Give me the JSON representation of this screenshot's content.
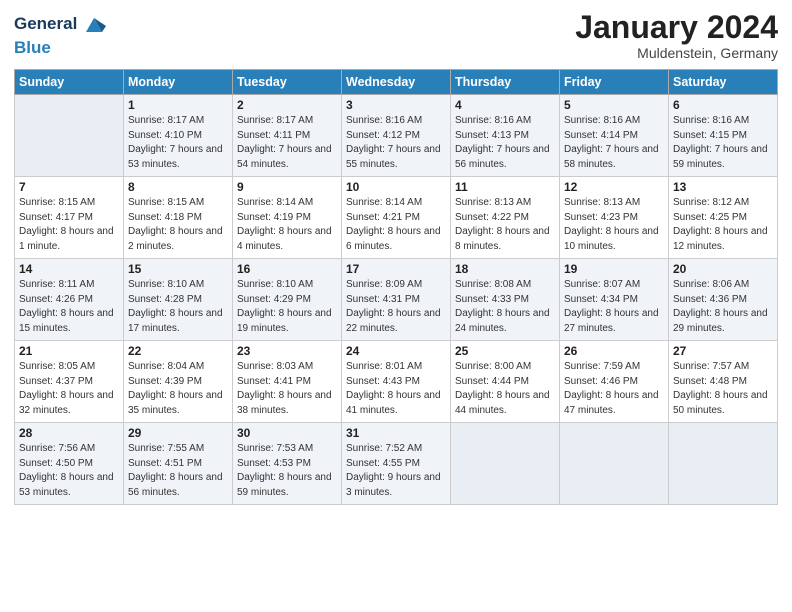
{
  "header": {
    "logo_line1": "General",
    "logo_line2": "Blue",
    "title": "January 2024",
    "subtitle": "Muldenstein, Germany"
  },
  "days_of_week": [
    "Sunday",
    "Monday",
    "Tuesday",
    "Wednesday",
    "Thursday",
    "Friday",
    "Saturday"
  ],
  "weeks": [
    [
      {
        "day": "",
        "empty": true
      },
      {
        "day": "1",
        "sunrise": "Sunrise: 8:17 AM",
        "sunset": "Sunset: 4:10 PM",
        "daylight": "Daylight: 7 hours and 53 minutes."
      },
      {
        "day": "2",
        "sunrise": "Sunrise: 8:17 AM",
        "sunset": "Sunset: 4:11 PM",
        "daylight": "Daylight: 7 hours and 54 minutes."
      },
      {
        "day": "3",
        "sunrise": "Sunrise: 8:16 AM",
        "sunset": "Sunset: 4:12 PM",
        "daylight": "Daylight: 7 hours and 55 minutes."
      },
      {
        "day": "4",
        "sunrise": "Sunrise: 8:16 AM",
        "sunset": "Sunset: 4:13 PM",
        "daylight": "Daylight: 7 hours and 56 minutes."
      },
      {
        "day": "5",
        "sunrise": "Sunrise: 8:16 AM",
        "sunset": "Sunset: 4:14 PM",
        "daylight": "Daylight: 7 hours and 58 minutes."
      },
      {
        "day": "6",
        "sunrise": "Sunrise: 8:16 AM",
        "sunset": "Sunset: 4:15 PM",
        "daylight": "Daylight: 7 hours and 59 minutes."
      }
    ],
    [
      {
        "day": "7",
        "sunrise": "Sunrise: 8:15 AM",
        "sunset": "Sunset: 4:17 PM",
        "daylight": "Daylight: 8 hours and 1 minute."
      },
      {
        "day": "8",
        "sunrise": "Sunrise: 8:15 AM",
        "sunset": "Sunset: 4:18 PM",
        "daylight": "Daylight: 8 hours and 2 minutes."
      },
      {
        "day": "9",
        "sunrise": "Sunrise: 8:14 AM",
        "sunset": "Sunset: 4:19 PM",
        "daylight": "Daylight: 8 hours and 4 minutes."
      },
      {
        "day": "10",
        "sunrise": "Sunrise: 8:14 AM",
        "sunset": "Sunset: 4:21 PM",
        "daylight": "Daylight: 8 hours and 6 minutes."
      },
      {
        "day": "11",
        "sunrise": "Sunrise: 8:13 AM",
        "sunset": "Sunset: 4:22 PM",
        "daylight": "Daylight: 8 hours and 8 minutes."
      },
      {
        "day": "12",
        "sunrise": "Sunrise: 8:13 AM",
        "sunset": "Sunset: 4:23 PM",
        "daylight": "Daylight: 8 hours and 10 minutes."
      },
      {
        "day": "13",
        "sunrise": "Sunrise: 8:12 AM",
        "sunset": "Sunset: 4:25 PM",
        "daylight": "Daylight: 8 hours and 12 minutes."
      }
    ],
    [
      {
        "day": "14",
        "sunrise": "Sunrise: 8:11 AM",
        "sunset": "Sunset: 4:26 PM",
        "daylight": "Daylight: 8 hours and 15 minutes."
      },
      {
        "day": "15",
        "sunrise": "Sunrise: 8:10 AM",
        "sunset": "Sunset: 4:28 PM",
        "daylight": "Daylight: 8 hours and 17 minutes."
      },
      {
        "day": "16",
        "sunrise": "Sunrise: 8:10 AM",
        "sunset": "Sunset: 4:29 PM",
        "daylight": "Daylight: 8 hours and 19 minutes."
      },
      {
        "day": "17",
        "sunrise": "Sunrise: 8:09 AM",
        "sunset": "Sunset: 4:31 PM",
        "daylight": "Daylight: 8 hours and 22 minutes."
      },
      {
        "day": "18",
        "sunrise": "Sunrise: 8:08 AM",
        "sunset": "Sunset: 4:33 PM",
        "daylight": "Daylight: 8 hours and 24 minutes."
      },
      {
        "day": "19",
        "sunrise": "Sunrise: 8:07 AM",
        "sunset": "Sunset: 4:34 PM",
        "daylight": "Daylight: 8 hours and 27 minutes."
      },
      {
        "day": "20",
        "sunrise": "Sunrise: 8:06 AM",
        "sunset": "Sunset: 4:36 PM",
        "daylight": "Daylight: 8 hours and 29 minutes."
      }
    ],
    [
      {
        "day": "21",
        "sunrise": "Sunrise: 8:05 AM",
        "sunset": "Sunset: 4:37 PM",
        "daylight": "Daylight: 8 hours and 32 minutes."
      },
      {
        "day": "22",
        "sunrise": "Sunrise: 8:04 AM",
        "sunset": "Sunset: 4:39 PM",
        "daylight": "Daylight: 8 hours and 35 minutes."
      },
      {
        "day": "23",
        "sunrise": "Sunrise: 8:03 AM",
        "sunset": "Sunset: 4:41 PM",
        "daylight": "Daylight: 8 hours and 38 minutes."
      },
      {
        "day": "24",
        "sunrise": "Sunrise: 8:01 AM",
        "sunset": "Sunset: 4:43 PM",
        "daylight": "Daylight: 8 hours and 41 minutes."
      },
      {
        "day": "25",
        "sunrise": "Sunrise: 8:00 AM",
        "sunset": "Sunset: 4:44 PM",
        "daylight": "Daylight: 8 hours and 44 minutes."
      },
      {
        "day": "26",
        "sunrise": "Sunrise: 7:59 AM",
        "sunset": "Sunset: 4:46 PM",
        "daylight": "Daylight: 8 hours and 47 minutes."
      },
      {
        "day": "27",
        "sunrise": "Sunrise: 7:57 AM",
        "sunset": "Sunset: 4:48 PM",
        "daylight": "Daylight: 8 hours and 50 minutes."
      }
    ],
    [
      {
        "day": "28",
        "sunrise": "Sunrise: 7:56 AM",
        "sunset": "Sunset: 4:50 PM",
        "daylight": "Daylight: 8 hours and 53 minutes."
      },
      {
        "day": "29",
        "sunrise": "Sunrise: 7:55 AM",
        "sunset": "Sunset: 4:51 PM",
        "daylight": "Daylight: 8 hours and 56 minutes."
      },
      {
        "day": "30",
        "sunrise": "Sunrise: 7:53 AM",
        "sunset": "Sunset: 4:53 PM",
        "daylight": "Daylight: 8 hours and 59 minutes."
      },
      {
        "day": "31",
        "sunrise": "Sunrise: 7:52 AM",
        "sunset": "Sunset: 4:55 PM",
        "daylight": "Daylight: 9 hours and 3 minutes."
      },
      {
        "day": "",
        "empty": true
      },
      {
        "day": "",
        "empty": true
      },
      {
        "day": "",
        "empty": true
      }
    ]
  ]
}
